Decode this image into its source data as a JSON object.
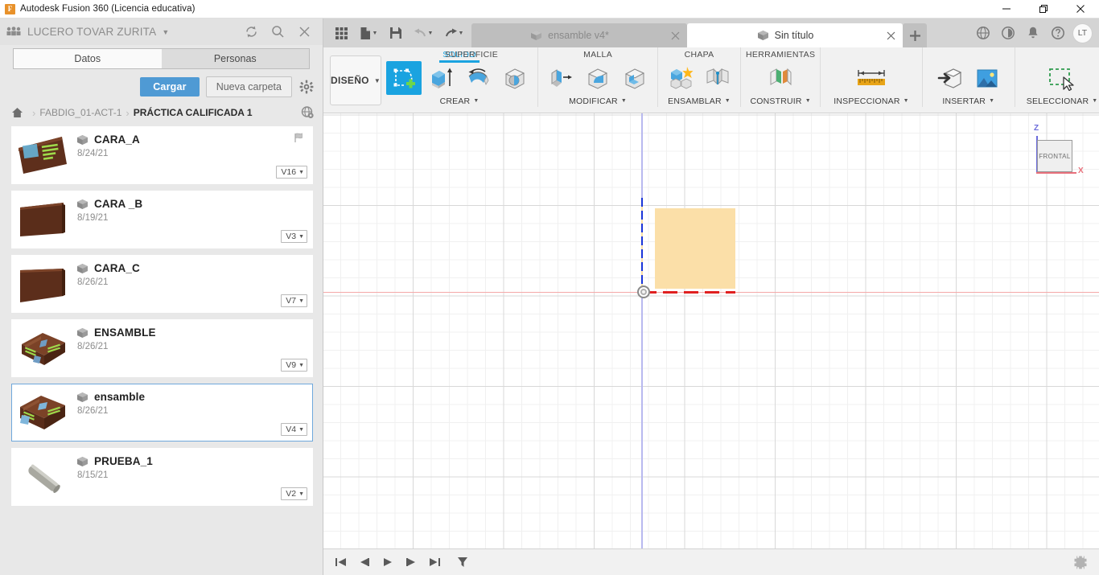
{
  "window": {
    "app_title": "Autodesk Fusion 360 (Licencia educativa)",
    "logo_letter": "F",
    "minimize_label": "Minimizar",
    "restore_label": "Restaurar",
    "close_label": "Cerrar"
  },
  "data_panel": {
    "team_name": "LUCERO TOVAR ZURITA",
    "team_icon": "people-icon",
    "caret_icon": "chevron-down-icon",
    "header_icons": [
      "refresh-icon",
      "search-icon",
      "close-icon"
    ],
    "tabs": [
      {
        "label": "Datos",
        "active": true
      },
      {
        "label": "Personas",
        "active": false
      }
    ],
    "actions": {
      "upload_label": "Cargar",
      "new_folder_label": "Nueva carpeta",
      "settings_icon": "gear-icon"
    },
    "breadcrumb": {
      "home_icon": "home-icon",
      "separator": "›",
      "items": [
        {
          "label": "FABDIG_01-ACT-1",
          "current": false
        },
        {
          "label": "PRÁCTICA CALIFICADA 1",
          "current": true
        }
      ],
      "globe_icon": "globe-eye-icon"
    },
    "files": [
      {
        "name": "CARA_A",
        "date": "8/24/21",
        "version": "V16",
        "selected": false,
        "flag": true,
        "thumb": "panel-blue-green"
      },
      {
        "name": "CARA _B",
        "date": "8/19/21",
        "version": "V3",
        "selected": false,
        "flag": false,
        "thumb": "panel-wood"
      },
      {
        "name": "CARA_C",
        "date": "8/26/21",
        "version": "V7",
        "selected": false,
        "flag": false,
        "thumb": "panel-wood2"
      },
      {
        "name": "ENSAMBLE",
        "date": "8/26/21",
        "version": "V9",
        "selected": false,
        "flag": false,
        "thumb": "box-assembly"
      },
      {
        "name": "ensamble",
        "date": "8/26/21",
        "version": "V4",
        "selected": true,
        "flag": false,
        "thumb": "box-assembly2"
      },
      {
        "name": "PRUEBA_1",
        "date": "8/15/21",
        "version": "V2",
        "selected": false,
        "flag": false,
        "thumb": "cylinder-rod"
      }
    ],
    "version_caret": "▼"
  },
  "quick_access": {
    "grid_icon": "app-grid-icon",
    "file_icon": "new-file-icon",
    "save_icon": "save-icon",
    "undo_icon": "undo-icon",
    "redo_icon": "redo-icon",
    "caret": "▼"
  },
  "document_tabs": [
    {
      "label": "ensamble v4*",
      "active": false,
      "close_icon": "close-icon",
      "doc_icon": "cube-icon"
    },
    {
      "label": "Sin título",
      "active": true,
      "close_icon": "close-icon",
      "doc_icon": "cube-icon"
    }
  ],
  "tab_add_icon": "plus-icon",
  "tab_right_icons": [
    "globe-share-icon",
    "job-status-icon",
    "notifications-bell-icon",
    "help-icon"
  ],
  "user_avatar": "LT",
  "ribbon": {
    "workspace_label": "DISEÑO",
    "workspace_caret": "▼",
    "ribbon_tabs": [
      {
        "label": "SOLIDO",
        "active": true
      },
      {
        "label": "SUPERFICIE",
        "active": false
      },
      {
        "label": "MALLA",
        "active": false
      },
      {
        "label": "CHAPA",
        "active": false
      },
      {
        "label": "HERRAMIENTAS",
        "active": false
      }
    ],
    "groups": [
      {
        "label": "CREAR",
        "caret": "▼",
        "buttons": [
          {
            "icon": "create-sketch-icon",
            "selected": true
          },
          {
            "icon": "extrude-icon",
            "selected": false
          },
          {
            "icon": "revolve-icon",
            "selected": false
          },
          {
            "icon": "hole-icon",
            "selected": false
          }
        ]
      },
      {
        "label": "MODIFICAR",
        "caret": "▼",
        "buttons": [
          {
            "icon": "press-pull-icon",
            "selected": false
          },
          {
            "icon": "fillet-icon",
            "selected": false
          },
          {
            "icon": "shell-icon",
            "selected": false
          }
        ]
      },
      {
        "label": "ENSAMBLAR",
        "caret": "▼",
        "buttons": [
          {
            "icon": "new-component-icon",
            "selected": false
          },
          {
            "icon": "joint-icon",
            "selected": false
          }
        ]
      },
      {
        "label": "CONSTRUIR",
        "caret": "▼",
        "buttons": [
          {
            "icon": "offset-plane-icon",
            "selected": false
          }
        ]
      },
      {
        "label": "INSPECCIONAR",
        "caret": "▼",
        "buttons": [
          {
            "icon": "measure-icon",
            "selected": false
          }
        ]
      },
      {
        "label": "INSERTAR",
        "caret": "▼",
        "buttons": [
          {
            "icon": "insert-derive-icon",
            "selected": false
          },
          {
            "icon": "insert-image-icon",
            "selected": false
          }
        ]
      },
      {
        "label": "SELECCIONAR",
        "caret": "▼",
        "buttons": [
          {
            "icon": "selection-marquee-icon",
            "selected": false
          }
        ]
      }
    ]
  },
  "viewcube": {
    "face_label": "FRONTAL",
    "z_label": "Z",
    "x_label": "X"
  },
  "canvas": {
    "sketch_fill_color": "#fbdfa8",
    "x_axis_color": "#e02020",
    "z_axis_color": "#1a35d8",
    "grid_minor_color": "#f0f0f0",
    "grid_major_color": "#d8d8d8"
  },
  "timeline": {
    "buttons": [
      "go-to-beginning-icon",
      "step-back-icon",
      "play-forward-icon",
      "step-forward-icon",
      "go-to-end-icon",
      "filter-icon"
    ],
    "settings_icon": "timeline-settings-icon"
  }
}
